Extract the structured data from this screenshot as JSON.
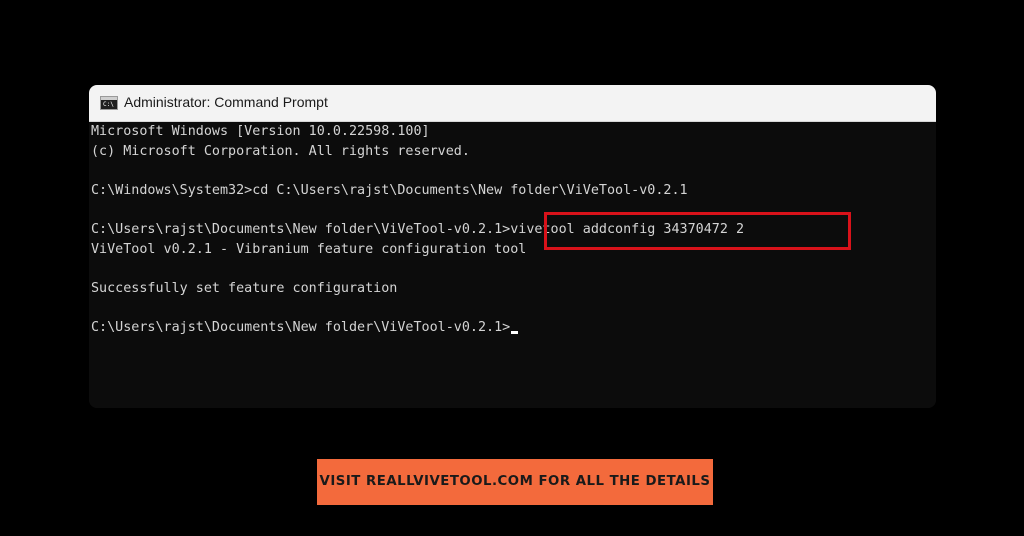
{
  "window": {
    "title": "Administrator: Command Prompt",
    "icon": "command-prompt-icon",
    "icon_glyph": "C:\\",
    "accent_highlight_color": "#d9121a"
  },
  "console": {
    "lines": [
      "Microsoft Windows [Version 10.0.22598.100]",
      "(c) Microsoft Corporation. All rights reserved.",
      "",
      "C:\\Windows\\System32>cd C:\\Users\\rajst\\Documents\\New folder\\ViVeTool-v0.2.1",
      "",
      "C:\\Users\\rajst\\Documents\\New folder\\ViVeTool-v0.2.1>vivetool addconfig 34370472 2",
      "ViVeTool v0.2.1 - Vibranium feature configuration tool",
      "",
      "Successfully set feature configuration",
      "",
      "C:\\Users\\rajst\\Documents\\New folder\\ViVeTool-v0.2.1>"
    ]
  },
  "banner": {
    "text": "VISIT REALLVIVETOOL.COM FOR ALL THE DETAILS",
    "color": "#f36a3c"
  }
}
